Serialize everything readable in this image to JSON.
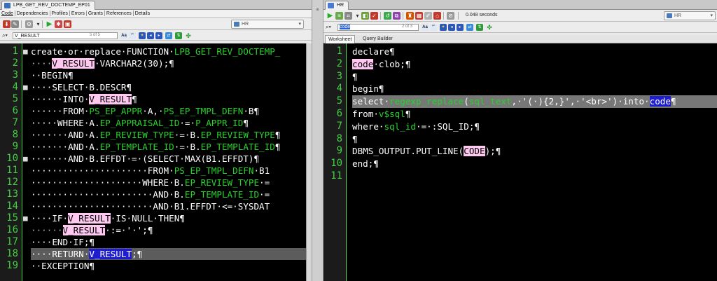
{
  "left": {
    "doc_tab": "LPB_GET_REV_DOCTEMP_EP01",
    "subtabs": [
      "Code",
      "Dependencies",
      "Profiles",
      "Errors",
      "Grants",
      "References",
      "Details"
    ],
    "connection": "HR",
    "find_value": "V_RESULT",
    "find_count": "5 of 5",
    "line_numbers": [
      "1",
      "2",
      "3",
      "4",
      "5",
      "6",
      "7",
      "8",
      "9",
      "10",
      "11",
      "12",
      "13",
      "14",
      "15",
      "16",
      "17",
      "18",
      "19"
    ],
    "lines": [
      [
        [
          "create·or·replace·FUNCTION·",
          "kw"
        ],
        [
          "LPB_GET_REV_DOCTEMP_",
          "id"
        ]
      ],
      [
        [
          "····",
          "ws"
        ],
        [
          "V_RESULT",
          "var"
        ],
        [
          "·VARCHAR2(30);¶",
          "kw"
        ]
      ],
      [
        [
          "··BEGIN¶",
          "kw"
        ]
      ],
      [
        [
          "····SELECT·B.DESCR¶",
          "kw"
        ]
      ],
      [
        [
          "······INTO·",
          "kw"
        ],
        [
          "V_RESULT",
          "var"
        ],
        [
          "¶",
          "kw"
        ]
      ],
      [
        [
          "······FROM·",
          "kw"
        ],
        [
          "PS_EP_APPR",
          "id"
        ],
        [
          "·A,·",
          "kw"
        ],
        [
          "PS_EP_TMPL_DEFN",
          "id"
        ],
        [
          "·B¶",
          "kw"
        ]
      ],
      [
        [
          "·····WHERE·A.",
          "kw"
        ],
        [
          "EP_APPRAISAL_ID",
          "id"
        ],
        [
          "·=·",
          "kw"
        ],
        [
          "P_APPR_ID",
          "id"
        ],
        [
          "¶",
          "kw"
        ]
      ],
      [
        [
          "·······AND·A.",
          "kw"
        ],
        [
          "EP_REVIEW_TYPE",
          "id"
        ],
        [
          "·=·B.",
          "kw"
        ],
        [
          "EP_REVIEW_TYPE",
          "id"
        ],
        [
          "¶",
          "kw"
        ]
      ],
      [
        [
          "·······AND·A.",
          "kw"
        ],
        [
          "EP_TEMPLATE_ID",
          "id"
        ],
        [
          "·=·B.",
          "kw"
        ],
        [
          "EP_TEMPLATE_ID",
          "id"
        ],
        [
          "¶",
          "kw"
        ]
      ],
      [
        [
          "·······AND·B.EFFDT·=·(SELECT·MAX(B1.EFFDT)¶",
          "kw"
        ]
      ],
      [
        [
          "······················FROM·",
          "kw"
        ],
        [
          "PS_EP_TMPL_DEFN",
          "id"
        ],
        [
          "·B1",
          "kw"
        ]
      ],
      [
        [
          "·····················WHERE·B.",
          "kw"
        ],
        [
          "EP_REVIEW_TYPE",
          "id"
        ],
        [
          "·=",
          "kw"
        ]
      ],
      [
        [
          "·······················AND·B.",
          "kw"
        ],
        [
          "EP_TEMPLATE_ID",
          "id"
        ],
        [
          "·=",
          "kw"
        ]
      ],
      [
        [
          "·······················AND·B1.EFFDT·<=·SYSDAT",
          "kw"
        ]
      ],
      [
        [
          "····IF·",
          "kw"
        ],
        [
          "V_RESULT",
          "var"
        ],
        [
          "·IS·NULL·THEN¶",
          "kw"
        ]
      ],
      [
        [
          "······",
          "ws"
        ],
        [
          "V_RESULT",
          "var"
        ],
        [
          "·:=·'·';¶",
          "kw"
        ]
      ],
      [
        [
          "····END·IF;¶",
          "kw"
        ]
      ],
      [
        [
          "····RETURN·",
          "kw"
        ],
        [
          "V_RESULT",
          "varsel"
        ],
        [
          ";¶",
          "kw"
        ]
      ],
      [
        [
          "··EXCEPTION¶",
          "kw"
        ]
      ]
    ]
  },
  "right": {
    "doc_tab": "HR",
    "elapsed": "0.048 seconds",
    "connection": "HR",
    "find_value": "code",
    "find_count": "2 of 3",
    "worksheet_tabs": [
      "Worksheet",
      "Query Builder"
    ],
    "line_numbers": [
      "1",
      "2",
      "3",
      "4",
      "5",
      "6",
      "7",
      "8",
      "9",
      "10",
      "11"
    ],
    "lines": [
      [
        [
          "declare¶",
          "kw"
        ]
      ],
      [
        [
          "code",
          "var"
        ],
        [
          "·clob;¶",
          "kw"
        ]
      ],
      [
        [
          "¶",
          "kw"
        ]
      ],
      [
        [
          "begin¶",
          "kw"
        ]
      ],
      [
        [
          "select·",
          "kw"
        ],
        [
          "regexp_replace",
          "id"
        ],
        [
          "(",
          "kw"
        ],
        [
          "sql_text",
          "id"
        ],
        [
          ",·'(·){2,}',·'<br>')·into·",
          "kw"
        ],
        [
          "code",
          "varsel"
        ],
        [
          "¶",
          "kw"
        ]
      ],
      [
        [
          "from·",
          "kw"
        ],
        [
          "v$sql",
          "id"
        ],
        [
          "¶",
          "kw"
        ]
      ],
      [
        [
          "where·",
          "kw"
        ],
        [
          "sql_id",
          "id"
        ],
        [
          "·=·:SQL_ID;¶",
          "kw"
        ]
      ],
      [
        [
          "¶",
          "kw"
        ]
      ],
      [
        [
          "DBMS_OUTPUT.PUT_LINE(",
          "kw"
        ],
        [
          "CODE",
          "var"
        ],
        [
          ");¶",
          "kw"
        ]
      ],
      [
        [
          "end;¶",
          "kw"
        ]
      ],
      [
        [
          "",
          "kw"
        ]
      ]
    ]
  },
  "colors": {
    "keyword": "#ffffff",
    "identifier": "#27d32a",
    "match_highlight": "#ffc8f0",
    "current_match": "#1e1ecf",
    "line_numbers": "#43d043",
    "editor_bg": "#000000"
  }
}
